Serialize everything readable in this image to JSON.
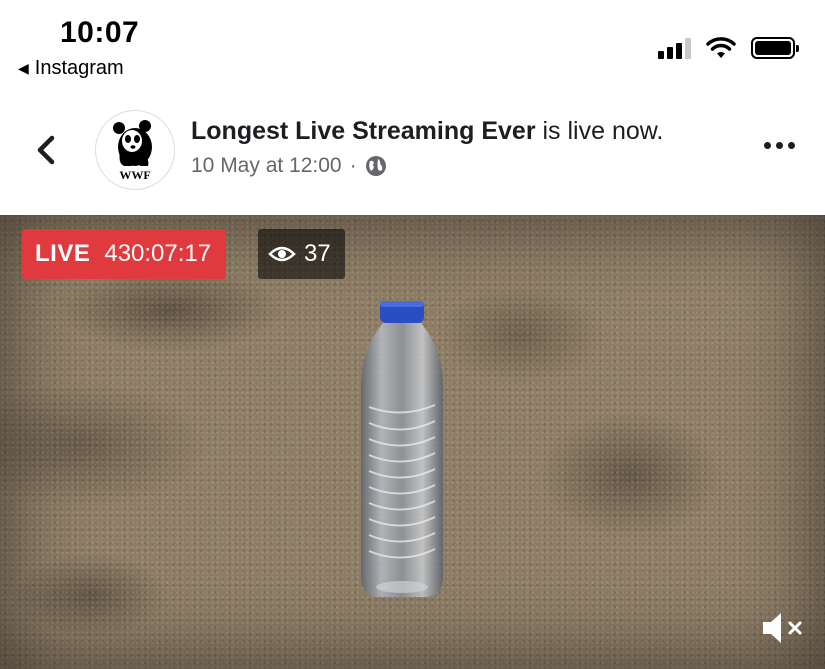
{
  "status_bar": {
    "time": "10:07",
    "back_app_label": "Instagram"
  },
  "post": {
    "page_name": "Longest Live Streaming Ever",
    "status_suffix": " is live now.",
    "date": "10 May at 12:00",
    "separator": "·",
    "privacy_icon": "globe-icon",
    "avatar_label": "WWF"
  },
  "video": {
    "live_label": "LIVE",
    "duration": "430:07:17",
    "viewer_count": "37",
    "mute_icon": "speaker-muted-icon"
  },
  "colors": {
    "live_red": "#e0393e",
    "meta_gray": "#65676b",
    "text_dark": "#1c1e21"
  }
}
